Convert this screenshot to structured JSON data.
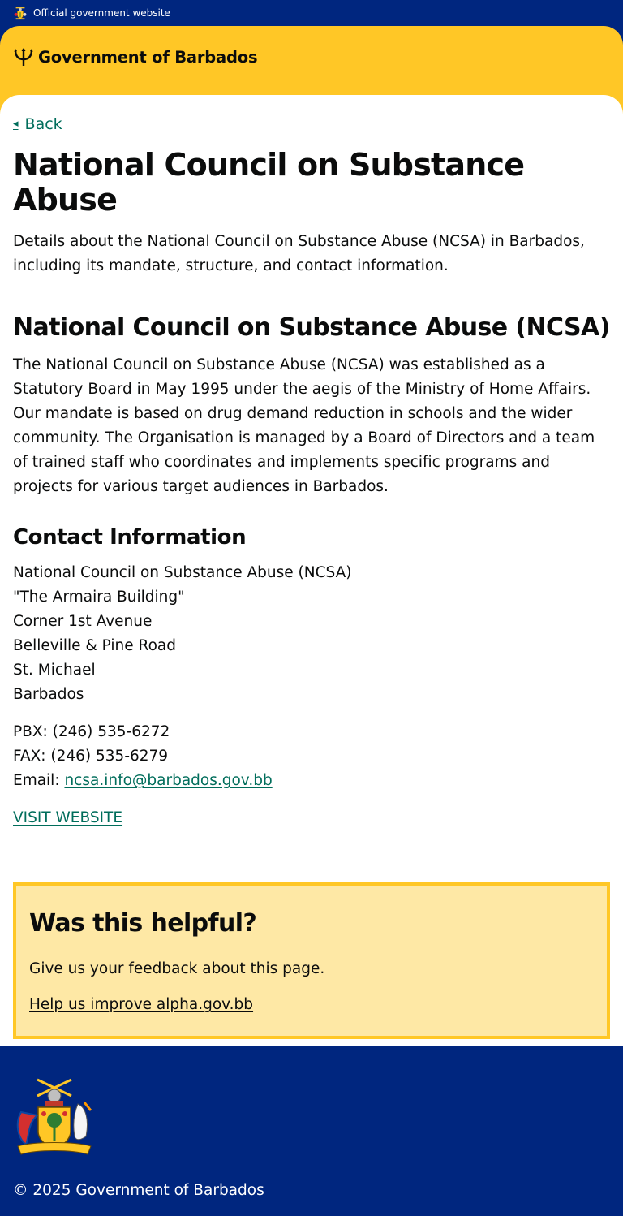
{
  "official_bar": {
    "text": "Official government website",
    "icon": "coat-of-arms-icon"
  },
  "header": {
    "brand": "Government of Barbados",
    "logo_icon": "trident-icon",
    "brand_color": "#ffc726",
    "bar_color": "#00267f"
  },
  "back_link": {
    "label": "Back",
    "icon": "back-arrow-icon"
  },
  "page": {
    "title": "National Council on Substance Abuse",
    "lede": "Details about the National Council on Substance Abuse (NCSA) in Barbados, including its mandate, structure, and contact information."
  },
  "section": {
    "title": "National Council on Substance Abuse (NCSA)",
    "body": "The National Council on Substance Abuse (NCSA) was established as a Statutory Board in May 1995 under the aegis of the Ministry of Home Affairs. Our mandate is based on drug demand reduction in schools and the wider community. The Organisation is managed by a Board of Directors and a team of trained staff who coordinates and implements specific programs and projects for various target audiences in Barbados."
  },
  "contact": {
    "title": "Contact Information",
    "address_lines": [
      "National Council on Substance Abuse (NCSA)",
      "\"The Armaira Building\"",
      "Corner 1st Avenue",
      "Belleville & Pine Road",
      "St. Michael",
      "Barbados"
    ],
    "pbx": "PBX: (246) 535-6272",
    "fax": "FAX: (246) 535-6279",
    "email_label": "Email:",
    "email": "ncsa.info@barbados.gov.bb",
    "visit_label": "VISIT WEBSITE",
    "link_color": "#006d5b"
  },
  "feedback": {
    "title": "Was this helpful?",
    "text": "Give us your feedback about this page.",
    "link": "Help us improve alpha.gov.bb"
  },
  "footer": {
    "copyright": "© 2025 Government of Barbados",
    "logo_icon": "coat-of-arms-icon"
  }
}
